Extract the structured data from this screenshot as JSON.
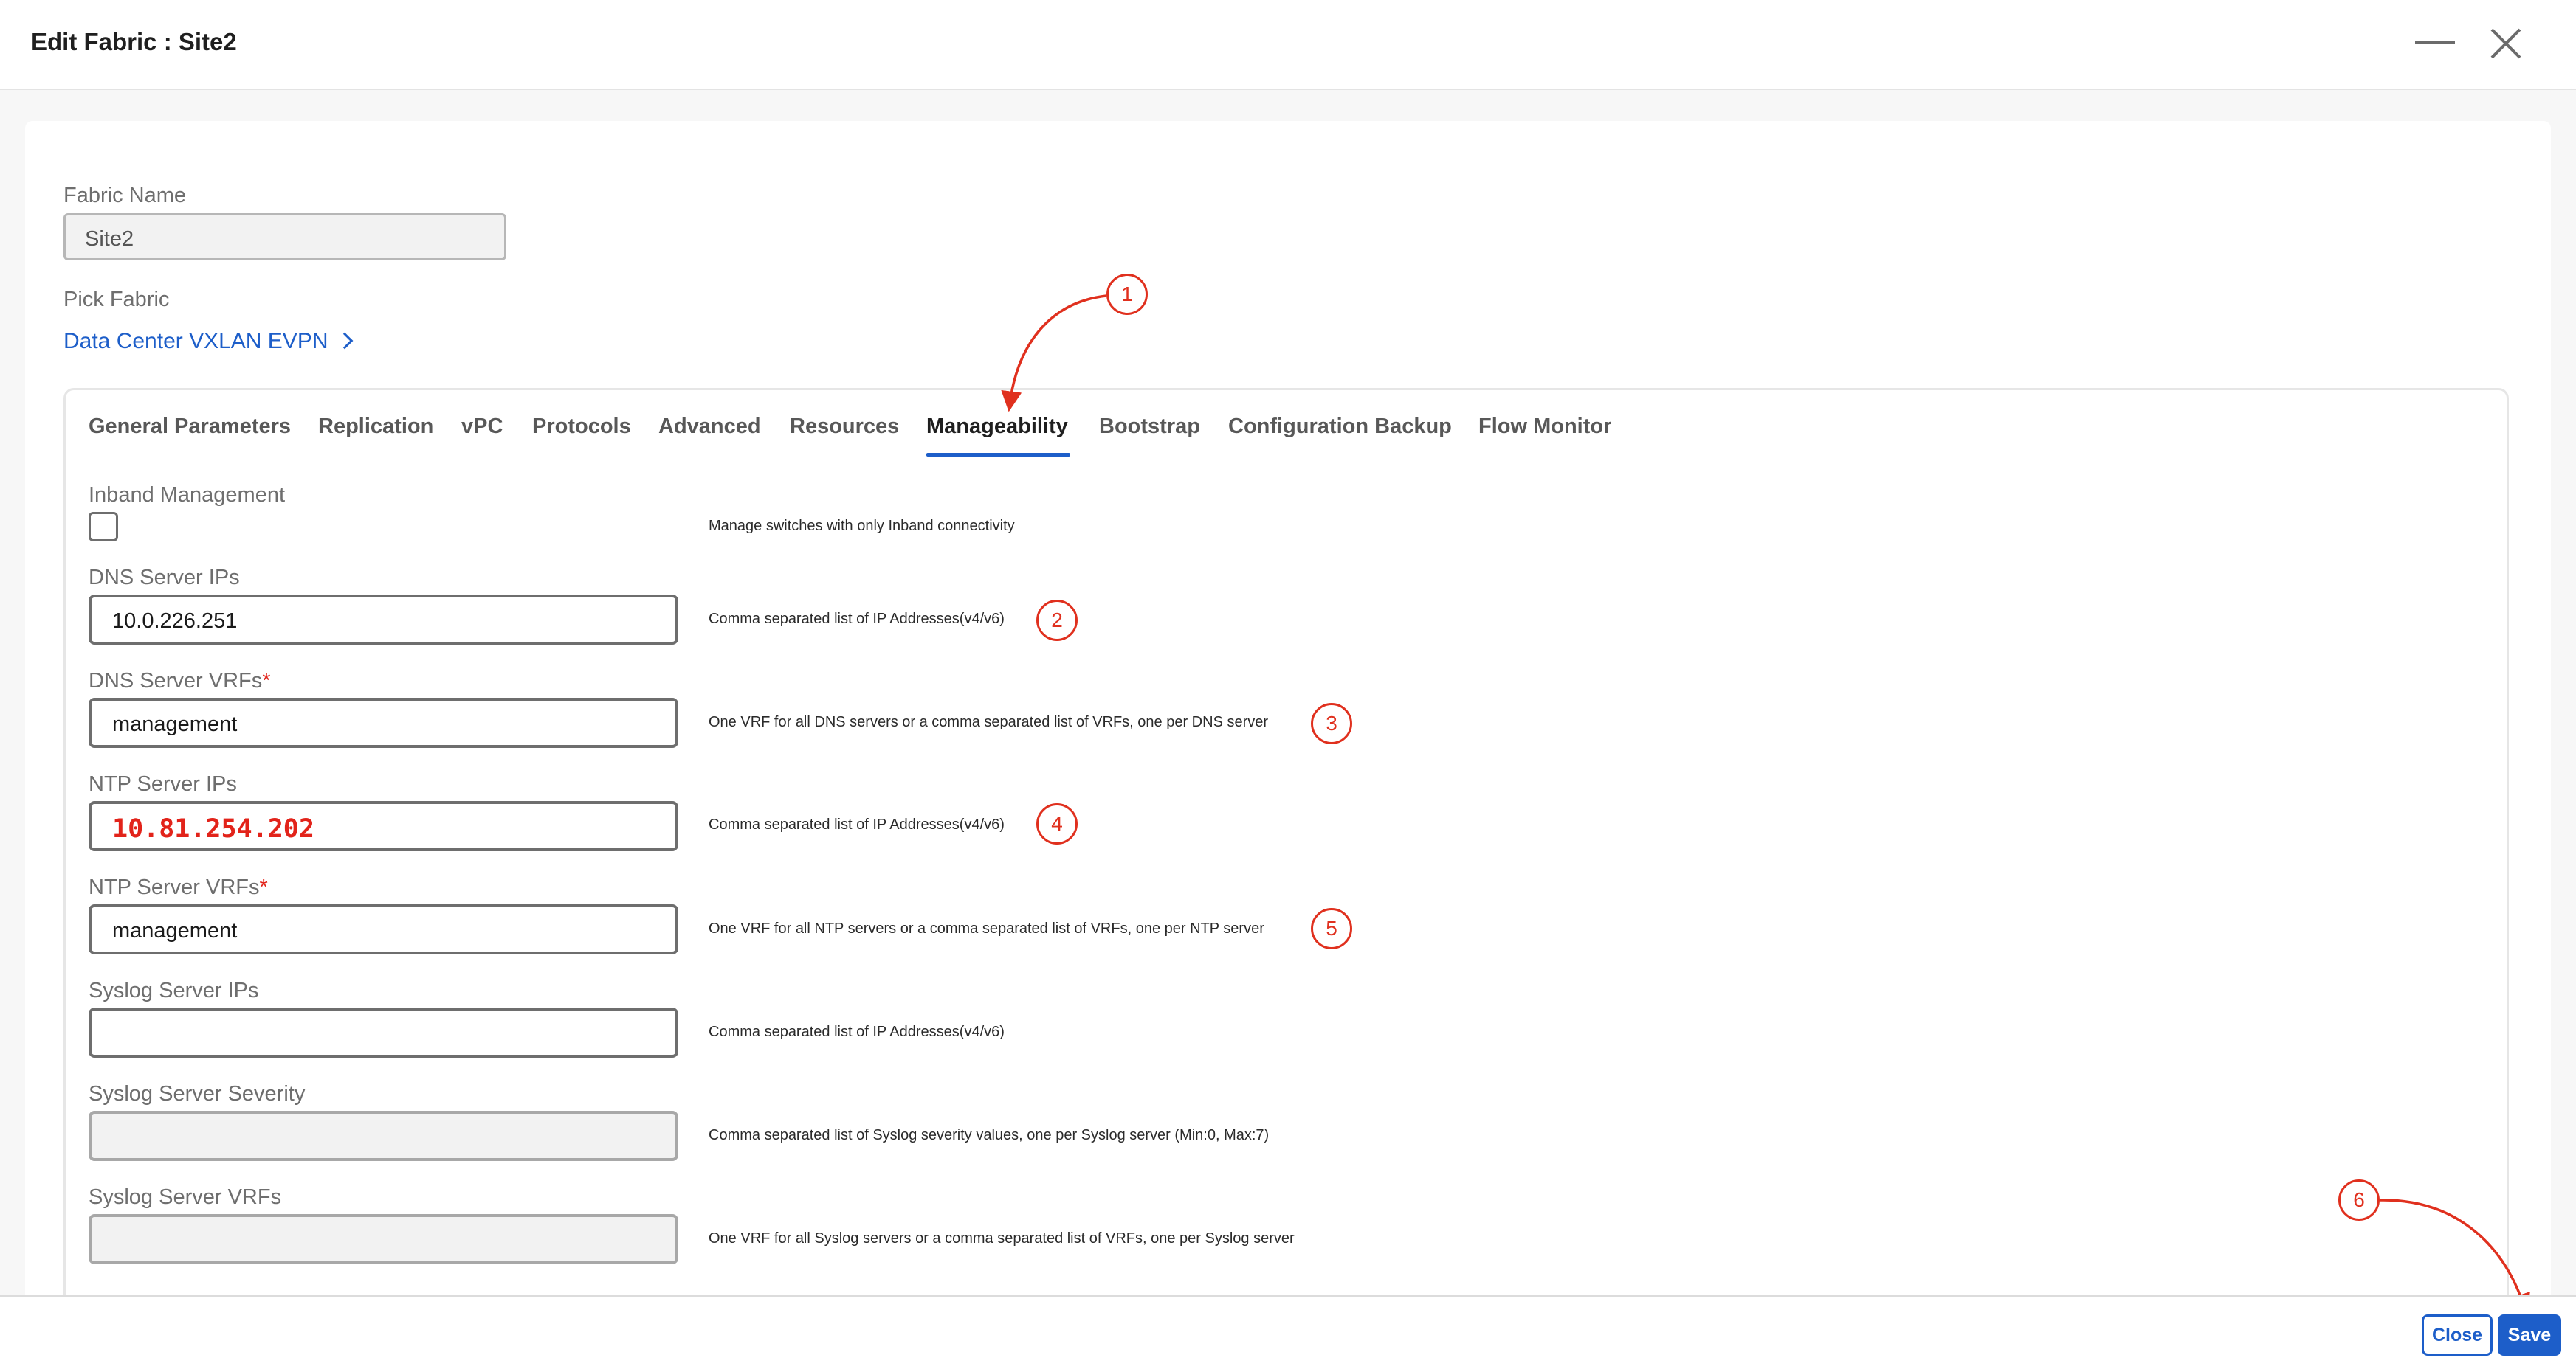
{
  "window": {
    "title": "Edit Fabric : Site2"
  },
  "fabric_name": {
    "label": "Fabric Name",
    "value": "Site2"
  },
  "pick_fabric": {
    "label": "Pick Fabric",
    "link": "Data Center VXLAN EVPN"
  },
  "tabs": [
    {
      "label": "General Parameters"
    },
    {
      "label": "Replication"
    },
    {
      "label": "vPC"
    },
    {
      "label": "Protocols"
    },
    {
      "label": "Advanced"
    },
    {
      "label": "Resources"
    },
    {
      "label": "Manageability",
      "active": true
    },
    {
      "label": "Bootstrap"
    },
    {
      "label": "Configuration Backup"
    },
    {
      "label": "Flow Monitor"
    }
  ],
  "fields": {
    "inband": {
      "label": "Inband Management",
      "checked": false,
      "help": "Manage switches with only Inband connectivity"
    },
    "dns_ips": {
      "label": "DNS Server IPs",
      "value": "10.0.226.251",
      "help": "Comma separated list of IP Addresses(v4/v6)"
    },
    "dns_vrfs": {
      "label": "DNS Server VRFs",
      "required_mark": "*",
      "value": "management",
      "help": "One VRF for all DNS servers or a comma separated list of VRFs, one per DNS server"
    },
    "ntp_ips": {
      "label": "NTP Server IPs",
      "value": "10.81.254.202",
      "help": "Comma separated list of IP Addresses(v4/v6)"
    },
    "ntp_vrfs": {
      "label": "NTP Server VRFs",
      "required_mark": "*",
      "value": "management",
      "help": "One VRF for all NTP servers or a comma separated list of VRFs, one per NTP server"
    },
    "syslog_ips": {
      "label": "Syslog Server IPs",
      "value": "",
      "help": "Comma separated list of IP Addresses(v4/v6)"
    },
    "syslog_severity": {
      "label": "Syslog Server Severity",
      "value": "",
      "help": "Comma separated list of Syslog severity values, one per Syslog server (Min:0, Max:7)"
    },
    "syslog_vrfs": {
      "label": "Syslog Server VRFs",
      "value": "",
      "help": "One VRF for all Syslog servers or a comma separated list of VRFs, one per Syslog server"
    }
  },
  "annotations": [
    "1",
    "2",
    "3",
    "4",
    "5",
    "6"
  ],
  "colors": {
    "accent": "#1d5ec9",
    "annotation": "#e0301e",
    "required": "#e2231a"
  },
  "buttons": {
    "close": "Close",
    "save": "Save"
  }
}
